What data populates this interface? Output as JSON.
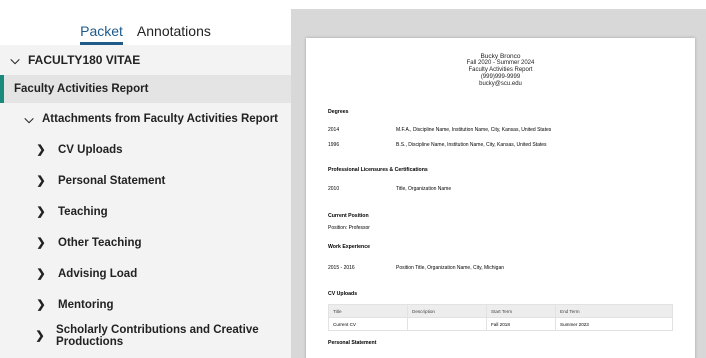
{
  "tabs": [
    {
      "label": "Packet"
    },
    {
      "label": "Annotations"
    }
  ],
  "tree": {
    "vitae": "FACULTY180 VITAE",
    "far": "Faculty Activities Report",
    "attachments": "Attachments from Faculty Activities Report",
    "items": [
      {
        "label": "CV Uploads"
      },
      {
        "label": "Personal Statement"
      },
      {
        "label": "Teaching"
      },
      {
        "label": "Other Teaching"
      },
      {
        "label": "Advising Load"
      },
      {
        "label": "Mentoring"
      },
      {
        "label": "Scholarly Contributions and Creative Productions"
      }
    ]
  },
  "document": {
    "header": {
      "name": "Bucky Bronco",
      "term": "Fall 2020 - Summer 2024",
      "report": "Faculty Activities Report",
      "phone": "(999)999-9999",
      "email": "bucky@scu.edu"
    },
    "degrees": {
      "title": "Degrees",
      "rows": [
        {
          "year": "2014",
          "text": "M.F.A., Discipline Name, Institution Name, City, Kansas, United States"
        },
        {
          "year": "1996",
          "text": "B.S., Discipline Name, Institution Name, City, Kansas, United States"
        }
      ]
    },
    "licensures": {
      "title": "Professional Licensures & Certifications",
      "rows": [
        {
          "year": "2010",
          "text": "Title, Organization Name"
        }
      ]
    },
    "current_position": {
      "title": "Current Position",
      "text": "Position: Professor"
    },
    "work": {
      "title": "Work Experience",
      "rows": [
        {
          "year": "2015 - 2016",
          "text": "Position Title, Organization Name, City, Michigan"
        }
      ]
    },
    "cv_uploads": {
      "title": "CV Uploads",
      "columns": [
        "Title",
        "Description",
        "Start Term",
        "End Term"
      ],
      "rows": [
        [
          "Current CV",
          "",
          "Fall 2018",
          "Summer 2023"
        ]
      ]
    },
    "personal_statement": {
      "title": "Personal Statement"
    }
  }
}
